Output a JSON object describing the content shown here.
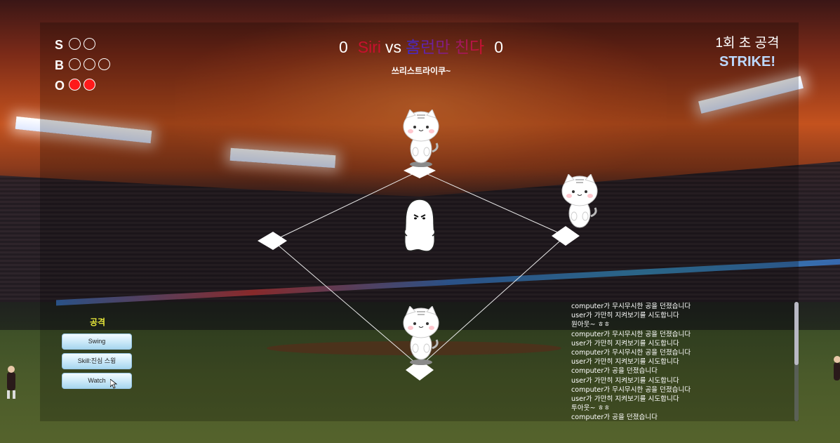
{
  "count": {
    "strike": {
      "label": "S",
      "filled": 0,
      "total": 2
    },
    "ball": {
      "label": "B",
      "filled": 0,
      "total": 3
    },
    "out": {
      "label": "O",
      "filled": 2,
      "total": 2
    }
  },
  "scoreboard": {
    "away_score": "0",
    "away_team": "Siri",
    "vs": "vs",
    "home_team": "홈런만 친다",
    "home_score": "0",
    "subtitle": "쓰리스트라이쿠~"
  },
  "inning": {
    "text": "1회 초 공격",
    "call": "STRIKE!"
  },
  "controls": {
    "title": "공격",
    "swing": "Swing",
    "skill": "Skill:진심 스윙",
    "watch": "Watch"
  },
  "log": [
    "computer가 무시무시한 공을 던졌습니다",
    "user가 가만히 지켜보기를 시도합니다",
    "원아웃~ ㅎㅎ",
    "computer가 무시무시한 공을 던졌습니다",
    "user가 가만히 지켜보기를 시도합니다",
    "computer가 무시무시한 공을 던졌습니다",
    "user가 가만히 지켜보기를 시도합니다",
    "computer가 공을 던졌습니다",
    "user가 가만히 지켜보기를 시도합니다",
    "computer가 무시무시한 공을 던졌습니다",
    "user가 가만히 지켜보기를 시도합니다",
    "투아웃~ ㅎㅎ",
    "computer가 공을 던졌습니다"
  ],
  "colors": {
    "out_dot": "#ff1a1a",
    "away_team": "#c8102e",
    "call": "#bcd9ff",
    "controls_title": "#e6e63a"
  },
  "icons": {
    "runner": "white-cat",
    "pitcher": "white-ghost",
    "base": "diamond-base"
  }
}
